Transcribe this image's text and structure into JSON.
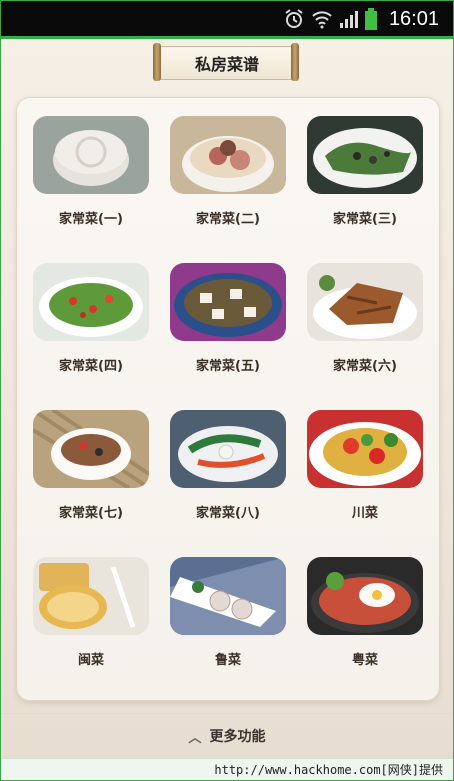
{
  "status_bar": {
    "time": "16:01",
    "icons": [
      "alarm-icon",
      "wifi-icon",
      "signal-icon",
      "battery-icon"
    ]
  },
  "header": {
    "title": "私房菜谱"
  },
  "recipes": [
    {
      "label": "家常菜(一)"
    },
    {
      "label": "家常菜(二)"
    },
    {
      "label": "家常菜(三)"
    },
    {
      "label": "家常菜(四)"
    },
    {
      "label": "家常菜(五)"
    },
    {
      "label": "家常菜(六)"
    },
    {
      "label": "家常菜(七)"
    },
    {
      "label": "家常菜(八)"
    },
    {
      "label": "川菜"
    },
    {
      "label": "闽菜"
    },
    {
      "label": "鲁菜"
    },
    {
      "label": "粤菜"
    }
  ],
  "bottom_bar": {
    "icon": "chevron-up-icon",
    "label": "更多功能"
  },
  "watermark": {
    "text": "http://www.hackhome.com[网侠]提供"
  },
  "colors": {
    "accent_green": "#2fae4a",
    "status_bar_bg": "#0a0a0a"
  }
}
